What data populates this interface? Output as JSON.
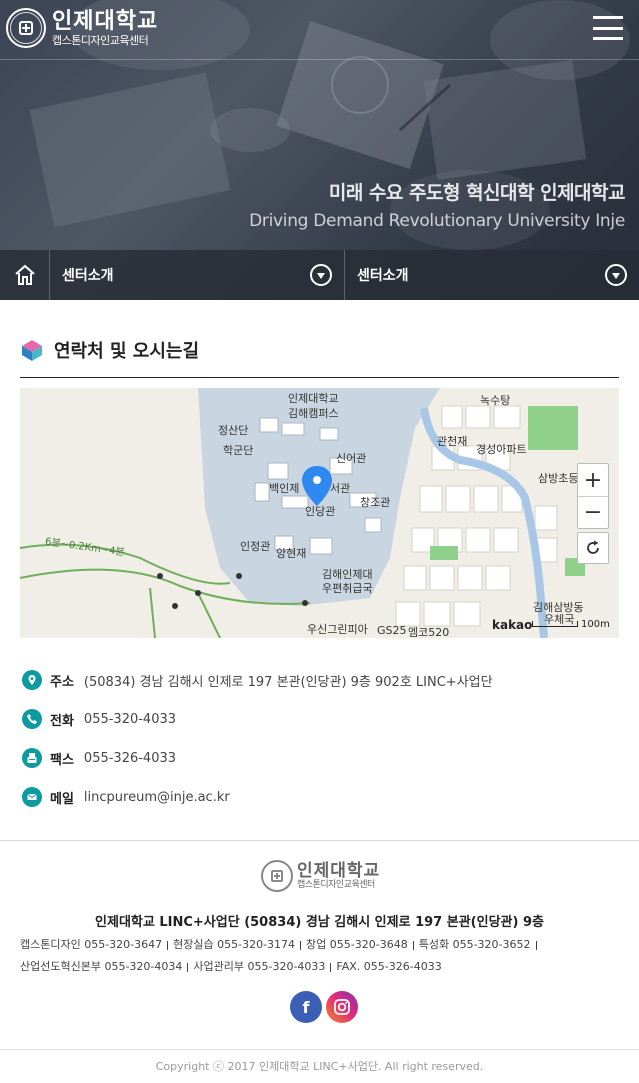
{
  "header": {
    "logo_title": "인제대학교",
    "logo_subtitle": "캡스톤디자인교육센터",
    "menu_icon": "hamburger-icon",
    "slogan_ko": "미래 수요 주도형 혁신대학 인제대학교",
    "slogan_en": "Driving Demand Revolutionary University Inje"
  },
  "subnav": {
    "home_icon": "home-icon",
    "select1": "센터소개",
    "select2": "센터소개"
  },
  "section": {
    "title": "연락처 및 오시는길"
  },
  "map": {
    "labels": {
      "campus1": "인제대학교",
      "campus2": "김해캠퍼스",
      "jeongsan": "정산단",
      "hakgun": "학군단",
      "sineo": "신어관",
      "baekin": "백인제",
      "seogwan": "서관",
      "injegwan": "인당관",
      "changjo": "창조관",
      "injeong": "인정관",
      "yanghyeon": "양현재",
      "postoffice1": "김해인제대",
      "postoffice2": "우편취급국",
      "gwancheon": "관천재",
      "gyeongseong": "경성아파트",
      "noksu": "녹수탕",
      "sambang": "삼방초등",
      "samdong1": "김해삼방동",
      "samdong2": "우체국",
      "woosin": "우신그린피아",
      "gs25": "GS25",
      "emco": "엠코520",
      "trail": "6분~0.2Km~4분"
    },
    "zoom_in": "+",
    "zoom_out": "−",
    "brand": "kakao",
    "scale": "100m"
  },
  "contact": [
    {
      "icon": "location-pin-icon",
      "label": "주소",
      "value": "(50834) 경남 김해시 인제로 197 본관(인당관) 9층 902호 LINC+사업단"
    },
    {
      "icon": "phone-icon",
      "label": "전화",
      "value": "055-320-4033"
    },
    {
      "icon": "fax-icon",
      "label": "팩스",
      "value": "055-326-4033"
    },
    {
      "icon": "mail-icon",
      "label": "메일",
      "value": "lincpureum@inje.ac.kr"
    }
  ],
  "footer": {
    "logo_title": "인제대학교",
    "logo_subtitle": "캡스톤디자인교육센터",
    "address": "인제대학교 LINC+사업단 (50834) 경남 김해시 인제로 197 본관(인당관) 9층",
    "phones": [
      "캡스톤디자인 055-320-3647",
      "현장실습 055-320-3174",
      "창업 055-320-3648",
      "특성화 055-320-3652",
      "산업선도혁신본부 055-320-4034",
      "사업관리부 055-320-4033",
      "FAX. 055-326-4033"
    ],
    "social": [
      "facebook-icon",
      "instagram-icon"
    ],
    "copyright": "Copyright ⓒ 2017 인제대학교 LINC+사업단. All right reserved."
  },
  "colors": {
    "accent": "#0d9aa0",
    "facebook": "#3b5eb6"
  }
}
